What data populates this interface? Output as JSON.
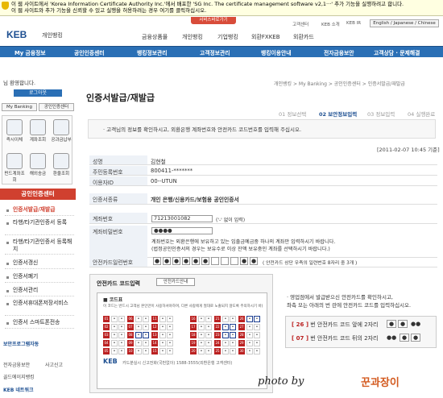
{
  "infobar": {
    "line1": "이 웹 사이트에서 'Korea Information Certificate Authority Inc.'에서 배포한 'SG Inc. The certificate management software v2,1···' 추가 기능을 실행하려고 합니다.",
    "line2": "이 웹 사이트와 추가 기능을 신뢰할 수 있고 실행을 허용하려는 경우 여기를 클릭하십시오."
  },
  "header": {
    "logo": "KEB",
    "logo_sub": "개인뱅킹",
    "service_btn": "서비스바로가기",
    "util": [
      "고객센터",
      "KEB 소개",
      "KEB IR"
    ],
    "lang": "English / Japanese / Chinese",
    "top_nav": [
      "금융상품몰",
      "개인뱅킹",
      "기업뱅킹",
      "외환FXKEB",
      "외환카드"
    ]
  },
  "main_nav": [
    "My 금융정보",
    "공인인증센터",
    "뱅킹정보관리",
    "고객정보관리",
    "뱅킹이용안내",
    "전자금융보안",
    "고객상담 · 문제해결"
  ],
  "sidebar": {
    "greeting": "님 환영합니다.",
    "logout": "로그아웃",
    "btn_mybanking": "My Banking",
    "btn_cert": "공인인증센터",
    "quick": [
      "즉시이체",
      "계좌조회",
      "공과금납부",
      "펀드계좌조회",
      "해외송금",
      "환율조회"
    ],
    "cert_center": "공인인증센터",
    "cert_menu": [
      "인증서발급/재발급",
      "타행/타기관인증서 등록",
      "타행/타기관인증서 등록해지",
      "인증서갱신",
      "인증서폐기",
      "인증서관리",
      "인증서휴대폰저장서비스",
      "인증서 스마트폰전송"
    ],
    "security": "보안프로그램자동",
    "bottom": [
      "전자금융보안",
      "사고신고",
      "골드에이지뱅킹",
      "KEB 네트워크"
    ]
  },
  "content": {
    "breadcrumb": "개인뱅킹 > My Banking > 공인인증센터 > 인증서발급/재발급",
    "title": "인증서발급/재발급",
    "steps": [
      "01 정보선택",
      "02 보안정보입력",
      "03 정보입력",
      "04 실행완료"
    ],
    "notice": "· 고객님의 정보를 확인하시고, 외환은행 계좌번호와 안전카드 코드번호를 입력해 주십시오.",
    "date": "[2011-02-07 10:45 기준]",
    "fields": [
      {
        "label": "성명",
        "value": "김현철"
      },
      {
        "label": "주민등록번호",
        "value": "800411-*******"
      },
      {
        "label": "이용자ID",
        "value": "00--UTUN"
      },
      {
        "label": "인증서종류",
        "value": "개인 은행/신용카드/보험용 공인인증서"
      }
    ],
    "account_label": "계좌번호",
    "account_value": "71213001082",
    "account_hint": "('-' 없이 입력)",
    "pw_label": "계좌비밀번호",
    "pw_value": "●●●●",
    "pw_note1": "계좌번호는 외환은행에 보유하고 있는 입출금예금중 하나의 계좌만 입력하시기 바랍니다.",
    "pw_note2": "(법정공인인증서의 경우는 보유수로 이상 잔액 보유중인 계좌를 선택하시기 바랍니다.)",
    "serial_label": "안전카드일련번호",
    "serial_cells": [
      "●",
      "●",
      "●",
      "●",
      "●",
      "●",
      "",
      "",
      "",
      "●",
      "●"
    ],
    "serial_note": "( 안전카드 상단 우측의 일련번호 8자리 중 3개 )",
    "card_title": "안전카드 코드입력",
    "card_btn": "안전카드안내",
    "card_head": "■ 코드표",
    "card_sub": "이 코드는 반드시 고객님 본인만이 사용하셔야하며, 다른 사람에게 절대로 노출되지 않도록 주의하시기 바랍니다.",
    "card_nums_left": [
      "01",
      "02",
      "03",
      "04",
      "05",
      "06",
      "07",
      "08",
      "09",
      "10",
      "11",
      "12",
      "13",
      "14",
      "15"
    ],
    "card_nums_right": [
      "16",
      "17",
      "18",
      "19",
      "20",
      "21",
      "22",
      "23",
      "24",
      "25",
      "26",
      "27",
      "28",
      "29",
      "30"
    ],
    "card_foot": "카드분실시 신고전화(국번없이) 1588-3555(외환은행 고객센터)",
    "card_logo": "KEB",
    "right_info1": "· 영업점에서 발급받으신 안전카드를 확인하시고,",
    "right_info2": "   좌측 모는 아래의 번 란에 안전카드 코드를 입력하십시오.",
    "q1_num": "[ 26 ]",
    "q1_text": "번 안전카드 코드 앞에 2자리",
    "q2_num": "[ 07 ]",
    "q2_text": "번 안전카드 코드 뒤의 2자리"
  },
  "watermark": "photo by",
  "watermark_sig": "꾼과장이"
}
